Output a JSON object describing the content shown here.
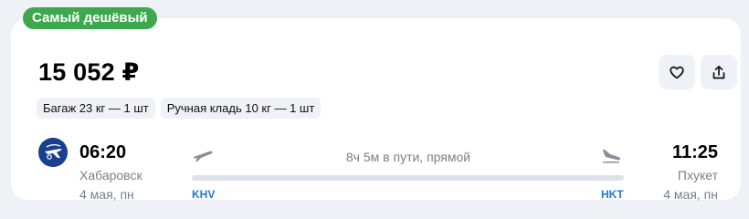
{
  "badge": {
    "label": "Самый дешёвый",
    "color": "#3ea84e"
  },
  "offer": {
    "price": "15 052 ₽"
  },
  "actions": {
    "favorite_icon": "heart-icon",
    "share_icon": "share-icon"
  },
  "baggage": [
    {
      "label": "Багаж 23 кг — 1 шт"
    },
    {
      "label": "Ручная кладь 10 кг — 1 шт"
    }
  ],
  "airline": {
    "logo_icon": "airline-logo-icon",
    "logo_color": "#1a3f8f"
  },
  "flight": {
    "departure": {
      "time": "06:20",
      "city": "Хабаровск",
      "date": "4 мая, пн",
      "iata": "KHV"
    },
    "arrival": {
      "time": "11:25",
      "city": "Пхукет",
      "date": "4 мая, пн",
      "iata": "HKT"
    },
    "duration": "8ч 5м в пути, прямой"
  },
  "colors": {
    "iata": "#1f78d1",
    "muted_text": "#7a7f87",
    "route_bar": "#dde2e8"
  }
}
